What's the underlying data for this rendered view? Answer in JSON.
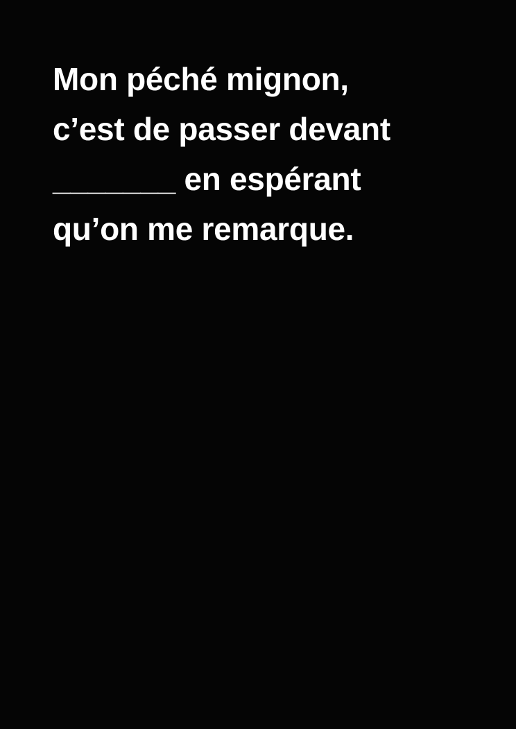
{
  "card": {
    "background_color": "#050505",
    "text_color": "#ffffff",
    "lines": [
      "Mon péché mignon,",
      "c’est de passer devant",
      "_______ en espérant",
      "qu’on me remarque."
    ]
  }
}
